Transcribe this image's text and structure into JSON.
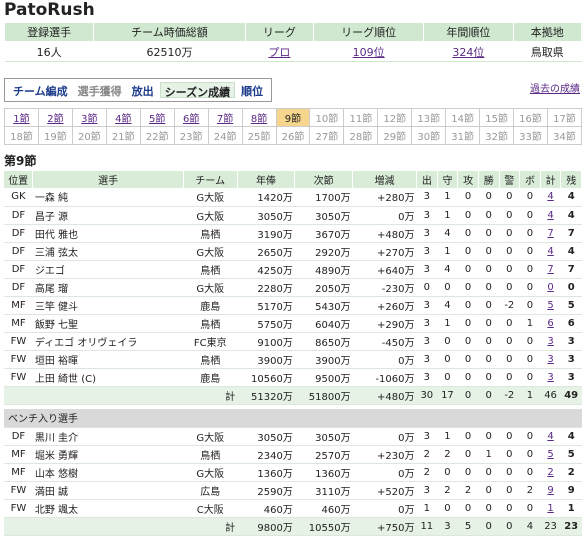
{
  "title": "PatoRush",
  "summary": {
    "headers": [
      "登録選手",
      "チーム時価総額",
      "リーグ",
      "リーグ順位",
      "年間順位",
      "本拠地"
    ],
    "players": "16人",
    "value": "62510万",
    "league": "プロ",
    "league_rank": "109位",
    "annual_rank": "324位",
    "home": "鳥取県"
  },
  "tabs": {
    "team": "チーム編成",
    "scout": "選手獲得",
    "release": "放出",
    "season": "シーズン成績",
    "rank": "順位"
  },
  "past_link": "過去の成績",
  "rounds": {
    "row1": [
      "1節",
      "2節",
      "3節",
      "4節",
      "5節",
      "6節",
      "7節",
      "8節",
      "9節",
      "10節",
      "11節",
      "12節",
      "13節",
      "14節",
      "15節",
      "16節",
      "17節"
    ],
    "row2": [
      "18節",
      "19節",
      "20節",
      "21節",
      "22節",
      "23節",
      "24節",
      "25節",
      "26節",
      "27節",
      "28節",
      "29節",
      "30節",
      "31節",
      "32節",
      "33節",
      "34節"
    ]
  },
  "round_title": "第9節",
  "table": {
    "headers": [
      "位置",
      "選手",
      "チーム",
      "年俸",
      "次節",
      "増減",
      "出",
      "守",
      "攻",
      "勝",
      "警",
      "ボ",
      "計",
      "残"
    ],
    "starters": [
      [
        "GK",
        "一森 純",
        "G大阪",
        "1420万",
        "1700万",
        "+280万",
        "3",
        "1",
        "0",
        "0",
        "0",
        "0",
        "4",
        "4"
      ],
      [
        "DF",
        "昌子 源",
        "G大阪",
        "3050万",
        "3050万",
        "0万",
        "3",
        "1",
        "0",
        "0",
        "0",
        "0",
        "4",
        "4"
      ],
      [
        "DF",
        "田代 雅也",
        "鳥栖",
        "3190万",
        "3670万",
        "+480万",
        "3",
        "4",
        "0",
        "0",
        "0",
        "0",
        "7",
        "7"
      ],
      [
        "DF",
        "三浦 弦太",
        "G大阪",
        "2650万",
        "2920万",
        "+270万",
        "3",
        "1",
        "0",
        "0",
        "0",
        "0",
        "4",
        "4"
      ],
      [
        "DF",
        "ジエゴ",
        "鳥栖",
        "4250万",
        "4890万",
        "+640万",
        "3",
        "4",
        "0",
        "0",
        "0",
        "0",
        "7",
        "7"
      ],
      [
        "DF",
        "高尾 瑠",
        "G大阪",
        "2280万",
        "2050万",
        "-230万",
        "0",
        "0",
        "0",
        "0",
        "0",
        "0",
        "0",
        "0"
      ],
      [
        "MF",
        "三竿 健斗",
        "鹿島",
        "5170万",
        "5430万",
        "+260万",
        "3",
        "4",
        "0",
        "0",
        "-2",
        "0",
        "5",
        "5"
      ],
      [
        "MF",
        "飯野 七聖",
        "鳥栖",
        "5750万",
        "6040万",
        "+290万",
        "3",
        "1",
        "0",
        "0",
        "0",
        "1",
        "6",
        "6"
      ],
      [
        "FW",
        "ディエゴ オリヴェイラ",
        "FC東京",
        "9100万",
        "8650万",
        "-450万",
        "3",
        "0",
        "0",
        "0",
        "0",
        "0",
        "3",
        "3"
      ],
      [
        "FW",
        "垣田 裕暉",
        "鳥栖",
        "3900万",
        "3900万",
        "0万",
        "3",
        "0",
        "0",
        "0",
        "0",
        "0",
        "3",
        "3"
      ],
      [
        "FW",
        "上田 綺世 (C)",
        "鹿島",
        "10560万",
        "9500万",
        "-1060万",
        "3",
        "0",
        "0",
        "0",
        "0",
        "0",
        "3",
        "3"
      ]
    ],
    "starters_total": [
      "計",
      "51320万",
      "51800万",
      "+480万",
      "30",
      "17",
      "0",
      "0",
      "-2",
      "1",
      "46",
      "49"
    ],
    "bench_label": "ベンチ入り選手",
    "bench": [
      [
        "DF",
        "黒川 圭介",
        "G大阪",
        "3050万",
        "3050万",
        "0万",
        "3",
        "1",
        "0",
        "0",
        "0",
        "0",
        "4",
        "4"
      ],
      [
        "MF",
        "堀米 勇輝",
        "鳥栖",
        "2340万",
        "2570万",
        "+230万",
        "2",
        "2",
        "0",
        "1",
        "0",
        "0",
        "5",
        "5"
      ],
      [
        "MF",
        "山本 悠樹",
        "G大阪",
        "1360万",
        "1360万",
        "0万",
        "2",
        "0",
        "0",
        "0",
        "0",
        "0",
        "2",
        "2"
      ],
      [
        "FW",
        "満田 誠",
        "広島",
        "2590万",
        "3110万",
        "+520万",
        "3",
        "2",
        "2",
        "0",
        "0",
        "2",
        "9",
        "9"
      ],
      [
        "FW",
        "北野 颯太",
        "C大阪",
        "460万",
        "460万",
        "0万",
        "1",
        "0",
        "0",
        "0",
        "0",
        "0",
        "1",
        "1"
      ]
    ],
    "bench_total": [
      "計",
      "9800万",
      "10550万",
      "+750万",
      "11",
      "3",
      "5",
      "0",
      "0",
      "4",
      "23",
      "23"
    ]
  },
  "colors": {
    "header_green": "#cfe8cf",
    "total_green": "#e6f2e6",
    "current_round": "#f6d68c",
    "link_purple": "#5b2a86",
    "tab_blue": "#1b3a8a"
  }
}
